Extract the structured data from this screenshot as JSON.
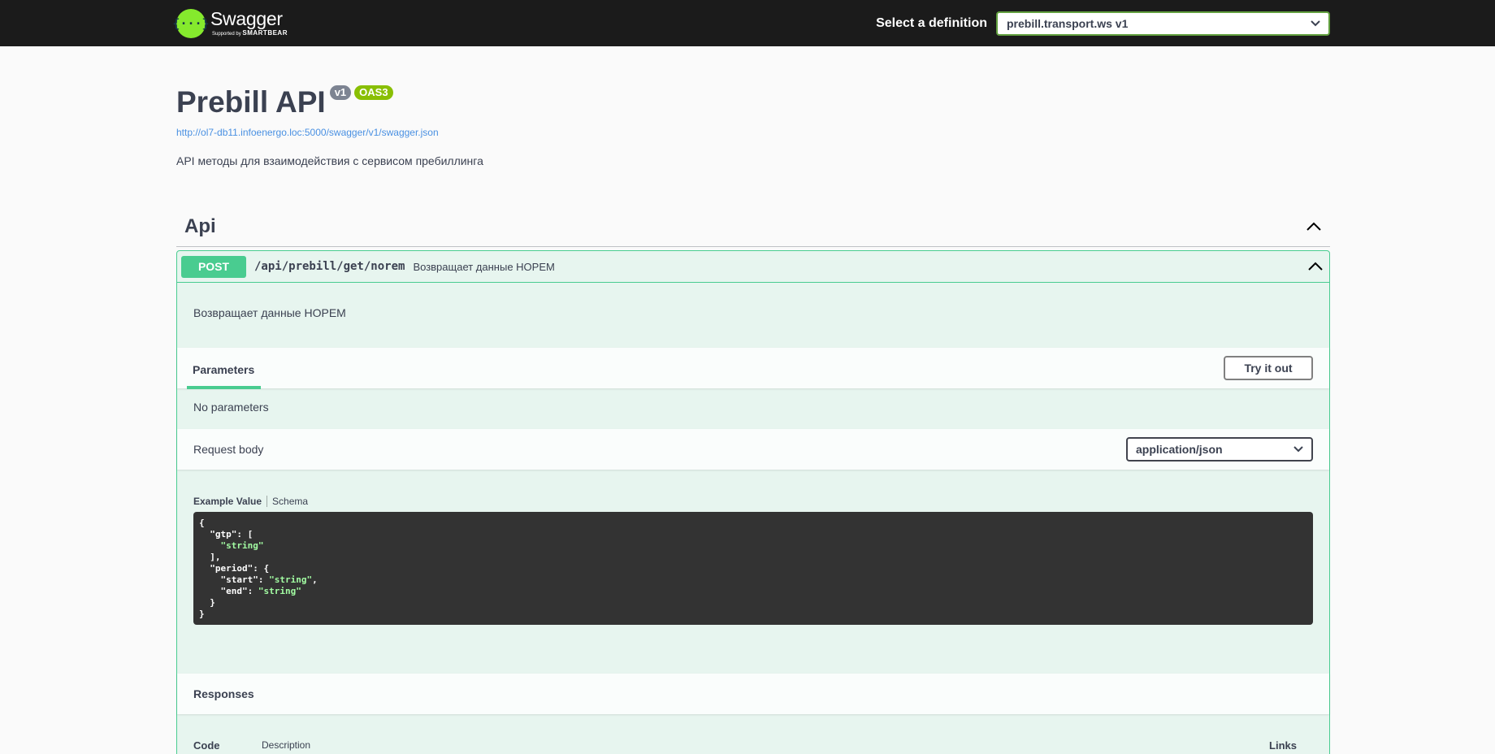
{
  "topbar": {
    "logo_glyph": "{···}",
    "logo_name": "Swagger",
    "logo_sub_prefix": "Supported by",
    "logo_sub_brand": "SMARTBEAR",
    "definition_label": "Select a definition",
    "definition_value": "prebill.transport.ws v1"
  },
  "info": {
    "title": "Prebill API",
    "version": "v1",
    "oas": "OAS3",
    "url": "http://ol7-db11.infoenergo.loc:5000/swagger/v1/swagger.json",
    "description": "API методы для взаимодействия с сервисом пребиллинга"
  },
  "tag": {
    "name": "Api"
  },
  "operation": {
    "method": "POST",
    "path": "/api/prebill/get/norem",
    "summary": "Возвращает данные НОРЕМ",
    "description": "Возвращает данные НОРЕМ",
    "parameters_tab": "Parameters",
    "try_it_out": "Try it out",
    "no_parameters": "No parameters",
    "request_body_label": "Request body",
    "content_type": "application/json",
    "example_value_tab": "Example Value",
    "schema_tab": "Schema",
    "example_json": "{\n  \"gtp\": [\n    \"string\"\n  ],\n  \"period\": {\n    \"start\": \"string\",\n    \"end\": \"string\"\n  }\n}",
    "responses_label": "Responses",
    "col_code": "Code",
    "col_description": "Description",
    "col_links": "Links"
  },
  "colors": {
    "post": "#49cc90",
    "topbar": "#1b1b1b",
    "logo": "#85ea2d",
    "oas_badge": "#89bf04",
    "link": "#4990e2"
  },
  "icons": {
    "dropdown": "chevron-down-icon",
    "collapse": "chevron-up-icon"
  }
}
